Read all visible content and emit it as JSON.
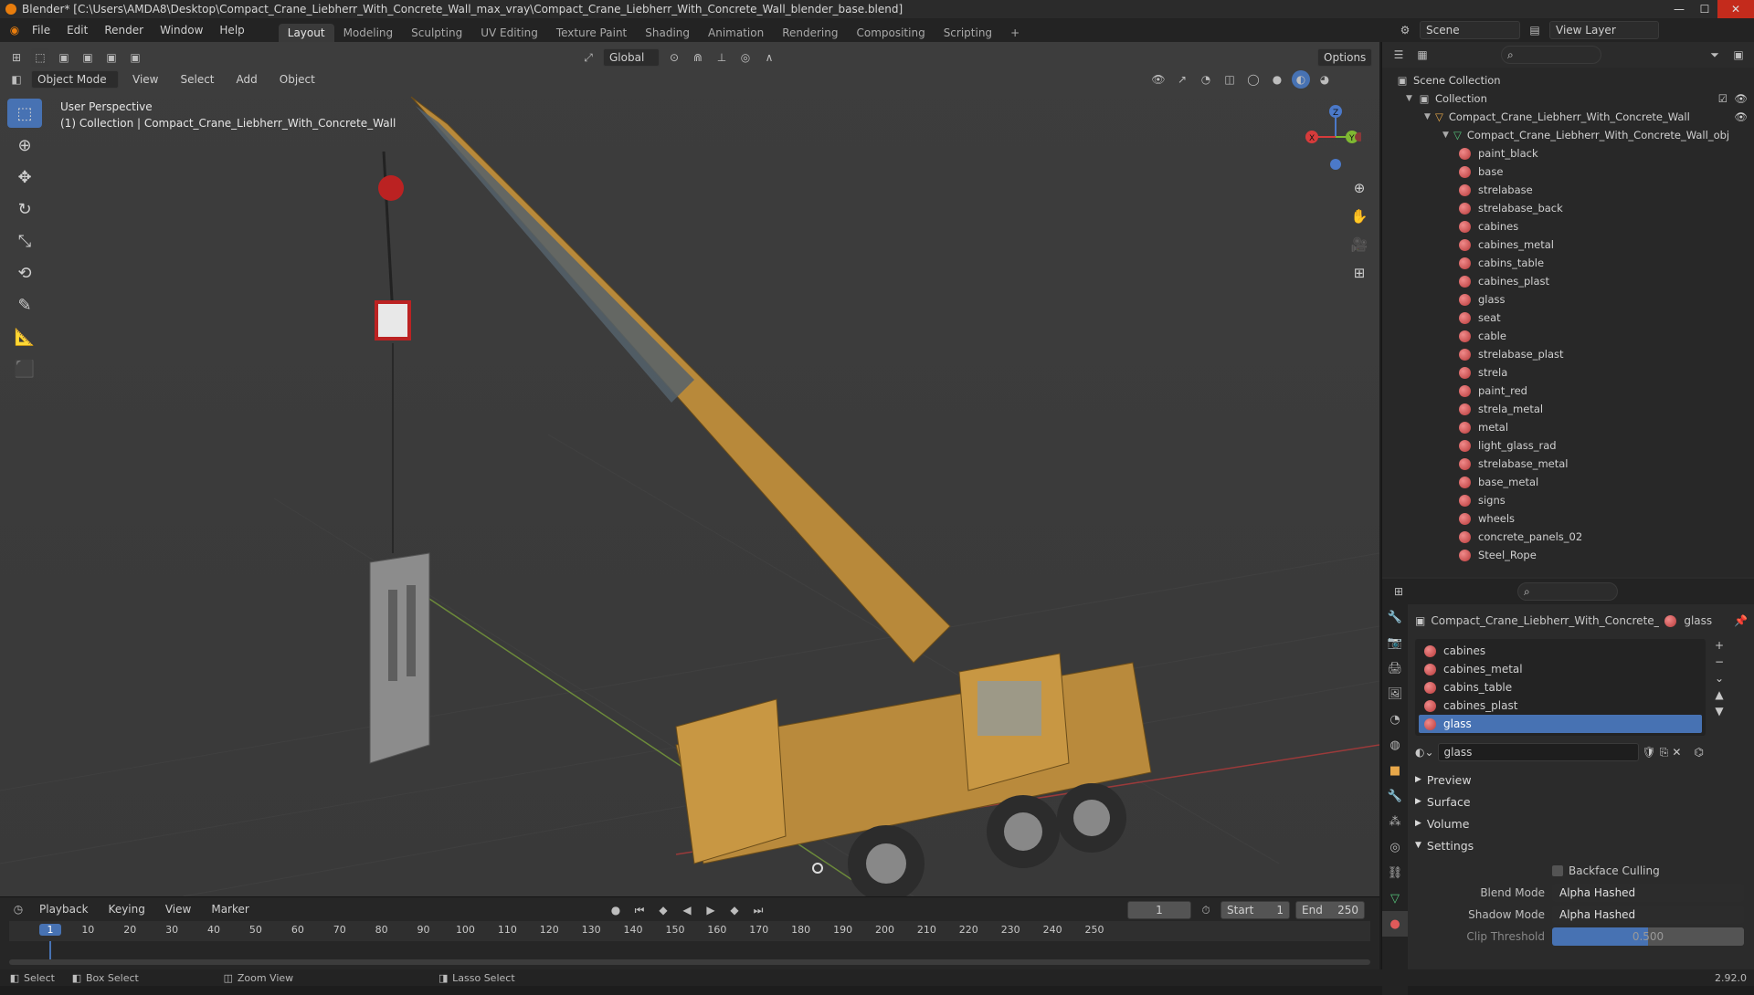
{
  "title_bar": {
    "text": "Blender* [C:\\Users\\AMDA8\\Desktop\\Compact_Crane_Liebherr_With_Concrete_Wall_max_vray\\Compact_Crane_Liebherr_With_Concrete_Wall_blender_base.blend]"
  },
  "menu": [
    "File",
    "Edit",
    "Render",
    "Window",
    "Help"
  ],
  "workspaces": [
    "Layout",
    "Modeling",
    "Sculpting",
    "UV Editing",
    "Texture Paint",
    "Shading",
    "Animation",
    "Rendering",
    "Compositing",
    "Scripting"
  ],
  "active_workspace": "Layout",
  "scene": {
    "label": "Scene",
    "view_layer": "View Layer"
  },
  "header": {
    "transform": "Global",
    "options": "Options"
  },
  "viewport_menu": {
    "mode": "Object Mode",
    "items": [
      "View",
      "Select",
      "Add",
      "Object"
    ]
  },
  "viewport_info": {
    "line1": "User Perspective",
    "line2": "(1) Collection | Compact_Crane_Liebherr_With_Concrete_Wall"
  },
  "gizmo": {
    "x": "X",
    "y": "Y",
    "z": "Z"
  },
  "outliner": {
    "scene_collection": "Scene Collection",
    "collection": "Collection",
    "object": "Compact_Crane_Liebherr_With_Concrete_Wall",
    "mesh": "Compact_Crane_Liebherr_With_Concrete_Wall_obj",
    "materials": [
      "paint_black",
      "base",
      "strelabase",
      "strelabase_back",
      "cabines",
      "cabines_metal",
      "cabins_table",
      "cabines_plast",
      "glass",
      "seat",
      "cable",
      "strelabase_plast",
      "strela",
      "paint_red",
      "strela_metal",
      "metal",
      "light_glass_rad",
      "strelabase_metal",
      "base_metal",
      "signs",
      "wheels",
      "concrete_panels_02",
      "Steel_Rope"
    ]
  },
  "properties": {
    "object_name": "Compact_Crane_Liebherr_With_Concrete_W...",
    "material_name": "glass",
    "slots": [
      "cabines",
      "cabines_metal",
      "cabins_table",
      "cabines_plast",
      "glass"
    ],
    "selected_slot": "glass",
    "material_field": "glass",
    "panels": [
      "Preview",
      "Surface",
      "Volume",
      "Settings"
    ],
    "backface": "Backface Culling",
    "blend_label": "Blend Mode",
    "blend_value": "Alpha Hashed",
    "shadow_label": "Shadow Mode",
    "shadow_value": "Alpha Hashed",
    "clip_label": "Clip Threshold",
    "clip_value": "0.500"
  },
  "timeline": {
    "menus": [
      "Playback",
      "Keying",
      "View",
      "Marker"
    ],
    "current_frame": "1",
    "start_label": "Start",
    "start": "1",
    "end_label": "End",
    "end": "250",
    "ticks": [
      "1",
      "10",
      "20",
      "30",
      "40",
      "50",
      "60",
      "70",
      "80",
      "90",
      "100",
      "110",
      "120",
      "130",
      "140",
      "150",
      "160",
      "170",
      "180",
      "190",
      "200",
      "210",
      "220",
      "230",
      "240",
      "250"
    ]
  },
  "status": {
    "select": "Select",
    "box_select": "Box Select",
    "zoom": "Zoom View",
    "lasso": "Lasso Select",
    "version": "2.92.0"
  }
}
